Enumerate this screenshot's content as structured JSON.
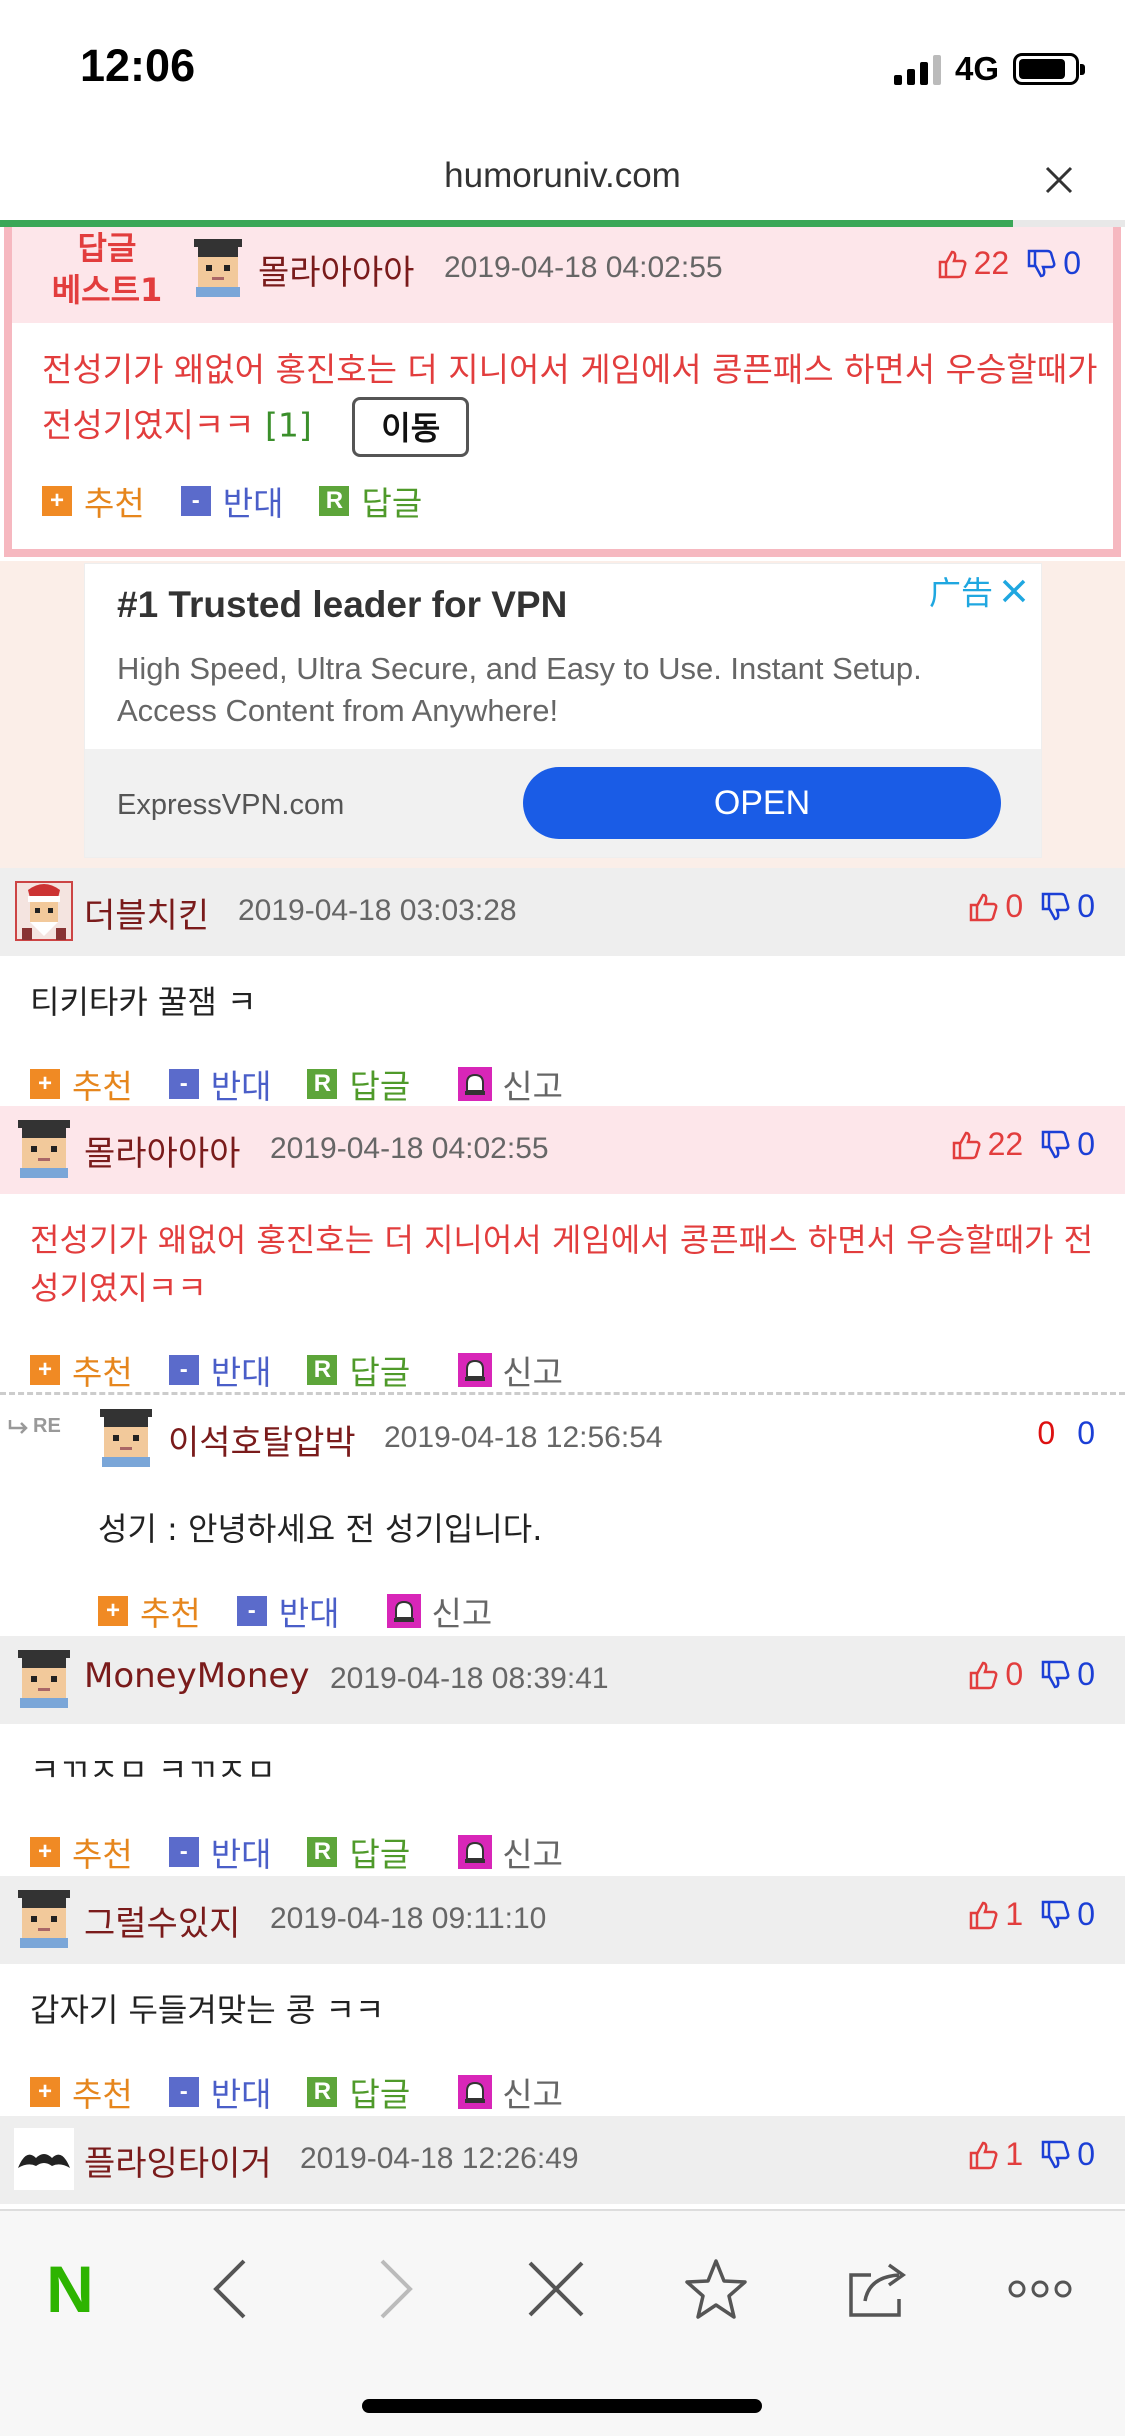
{
  "status_bar": {
    "time": "12:06",
    "network": "4G"
  },
  "url_bar": {
    "url": "humoruniv.com",
    "load_progress_pct": 90
  },
  "best_reply": {
    "label": "답글\n베스트1",
    "author": "몰라아아아",
    "date": "2019-04-18 04:02:55",
    "up": "22",
    "down": "0",
    "text": "전성기가 왜없어 홍진호는 더 지니어서 게임에서 콩픈패스 하면서 우승할때가 전성기였지ㅋㅋ",
    "reply_count": "[1]",
    "move_label": "이동"
  },
  "actions": {
    "recommend": "추천",
    "oppose": "반대",
    "reply": "답글",
    "report": "신고",
    "recommend_icon": "+",
    "oppose_icon": "-",
    "reply_icon": "R"
  },
  "ad": {
    "badge": "广告",
    "title": "#1 Trusted leader for VPN",
    "description": "High Speed, Ultra Secure, and Easy to Use. Instant Setup. Access Content from Anywhere!",
    "domain": "ExpressVPN.com",
    "cta": "OPEN"
  },
  "comments": [
    {
      "author": "더블치킨",
      "date": "2019-04-18 03:03:28",
      "up": "0",
      "down": "0",
      "text": "티키타카 꿀잼 ㅋ"
    },
    {
      "author": "몰라아아아",
      "date": "2019-04-18 04:02:55",
      "up": "22",
      "down": "0",
      "text": "전성기가 왜없어 홍진호는 더 지니어서 게임에서 콩픈패스 하면서 우승할때가 전성기였지ㅋㅋ"
    },
    {
      "author": "이석호탈압박",
      "date": "2019-04-18 12:56:54",
      "up": "0",
      "down": "0",
      "text": "성기 : 안녕하세요 전 성기입니다.",
      "re_label": "RE"
    },
    {
      "author": "MoneyMoney",
      "date": "2019-04-18 08:39:41",
      "up": "0",
      "down": "0",
      "text": "ㅋㄲㅈㅁ ㅋㄲㅈㅁ"
    },
    {
      "author": "그럴수있지",
      "date": "2019-04-18 09:11:10",
      "up": "1",
      "down": "0",
      "text": "갑자기 두들겨맞는 콩 ㅋㅋ"
    },
    {
      "author": "플라잉타이거",
      "date": "2019-04-18 12:26:49",
      "up": "1",
      "down": "0"
    }
  ],
  "toolbar": {
    "home_letter": "N"
  },
  "icons": [
    "thumbs-up-icon",
    "thumbs-down-icon",
    "close-icon",
    "back-icon",
    "forward-icon",
    "star-icon",
    "share-icon",
    "more-icon",
    "report-bell-icon"
  ]
}
